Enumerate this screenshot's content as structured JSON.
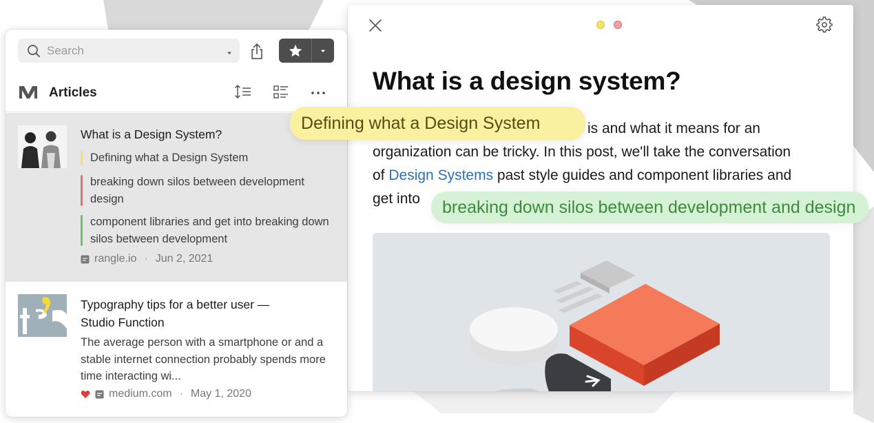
{
  "search": {
    "placeholder": "Search"
  },
  "section": {
    "title": "Articles"
  },
  "articles": [
    {
      "title": "What is a Design System?",
      "highlights": [
        {
          "text": "Defining what a Design System",
          "color": "#f2e462"
        },
        {
          "text": "breaking down silos between development design",
          "color": "#ef6b6b"
        },
        {
          "text": "component libraries and get into breaking down silos between development",
          "color": "#6cc36c"
        }
      ],
      "source": "rangle.io",
      "date": "Jun 2, 2021"
    },
    {
      "title": "Typography tips for a better user — Studio Function",
      "excerpt": "The average person with a smartphone or and a stable internet connection probably spends more time interacting wi...",
      "source": "medium.com",
      "date": "May 1, 2020",
      "favorited": true
    }
  ],
  "reader": {
    "title": "What is a design system?",
    "body_line1_rest": "is and what it means for an",
    "body_line2": "organization can be tricky. In this post, we'll take the conversation",
    "body_line3_pre": "of ",
    "body_line3_link": "Design Systems",
    "body_line3_post": " past style guides and component libraries and",
    "body_line4_pre": "get into"
  },
  "bubbles": {
    "yellow": "Defining what a Design System",
    "green": "breaking down silos between development and design"
  },
  "colors": {
    "accent_link": "#2d6fb8",
    "highlight_yellow": "#faf1a0",
    "highlight_green": "#d6f2d6",
    "window_dot_1": "#f5e46a",
    "window_dot_2": "#f3a0a0",
    "favorite_heart": "#e03a3a"
  },
  "icons": {
    "search": "search-icon",
    "caret": "chevron-down-icon",
    "share": "share-icon",
    "star": "star-icon",
    "logo": "medium-logo",
    "sort": "sort-icon",
    "list": "list-view-icon",
    "more": "more-icon",
    "close": "close-icon",
    "gear": "gear-icon",
    "heart": "heart-icon",
    "doc": "document-icon"
  }
}
